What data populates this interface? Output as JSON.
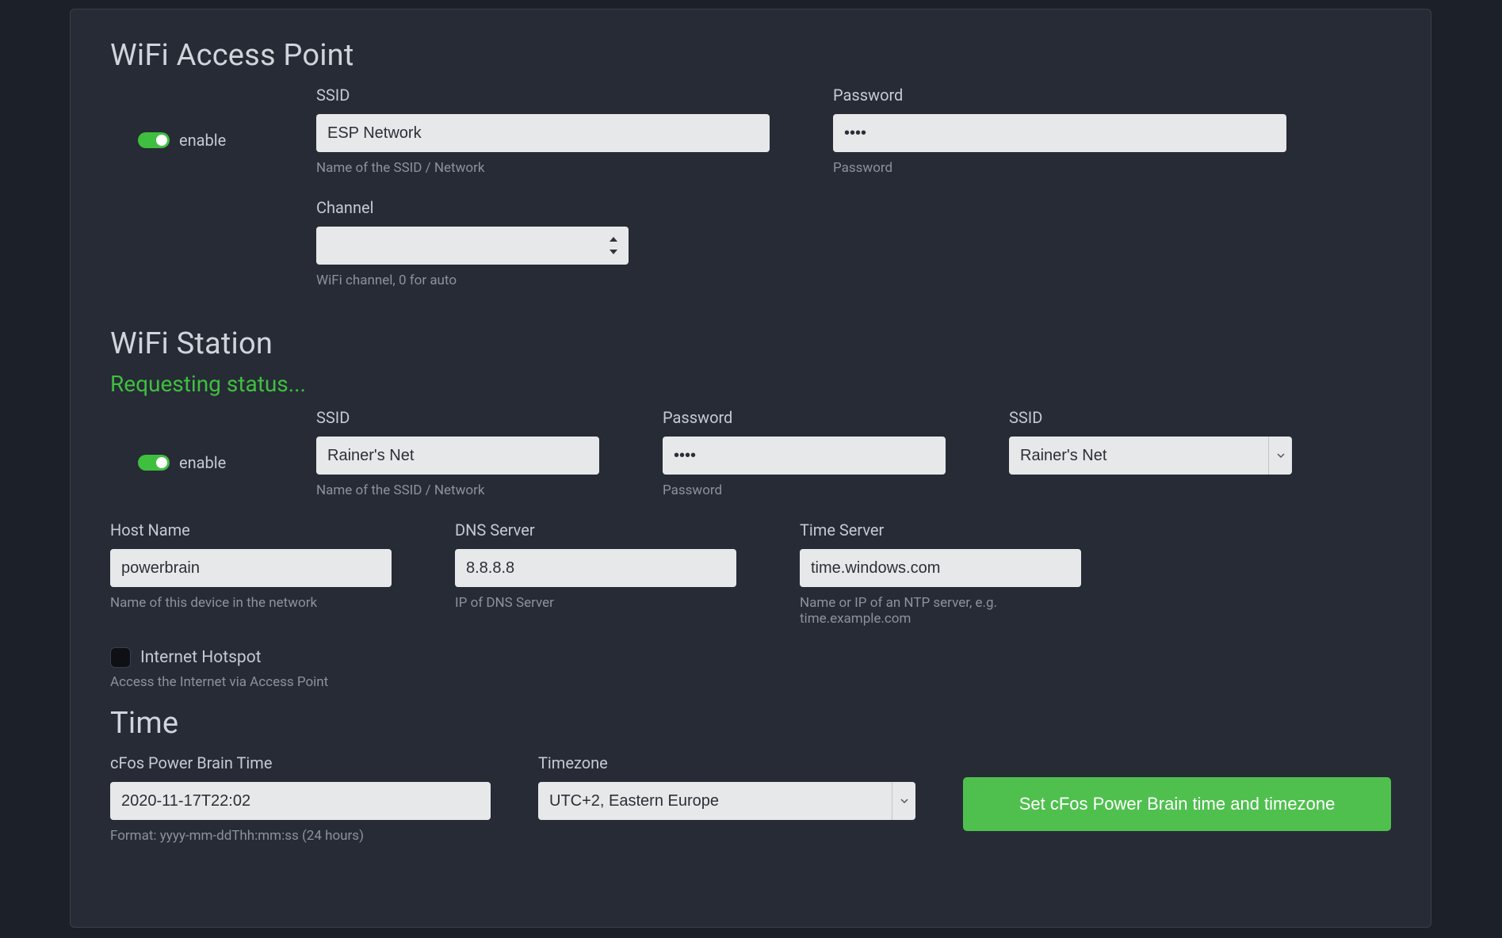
{
  "ap": {
    "title": "WiFi Access Point",
    "enable_label": "enable",
    "ssid_label": "SSID",
    "ssid_value": "ESP Network",
    "ssid_help": "Name of the SSID / Network",
    "password_label": "Password",
    "password_value": "••••",
    "password_help": "Password",
    "channel_label": "Channel",
    "channel_value": "",
    "channel_help": "WiFi channel, 0 for auto"
  },
  "station": {
    "title": "WiFi Station",
    "status": "Requesting status...",
    "enable_label": "enable",
    "ssid_label": "SSID",
    "ssid_value": "Rainer's Net",
    "ssid_help": "Name of the SSID / Network",
    "password_label": "Password",
    "password_value": "••••",
    "password_help": "Password",
    "ssid_select_label": "SSID",
    "ssid_select_value": "Rainer's Net",
    "host_label": "Host Name",
    "host_value": "powerbrain",
    "host_help": "Name of this device in the network",
    "dns_label": "DNS Server",
    "dns_value": "8.8.8.8",
    "dns_help": "IP of DNS Server",
    "timeserver_label": "Time Server",
    "timeserver_value": "time.windows.com",
    "timeserver_help": "Name or IP of an NTP server, e.g. time.example.com",
    "hotspot_label": "Internet Hotspot",
    "hotspot_help": "Access the Internet via Access Point"
  },
  "time": {
    "title": "Time",
    "clock_label": "cFos Power Brain Time",
    "clock_value": "2020-11-17T22:02",
    "clock_help": "Format: yyyy-mm-ddThh:mm:ss (24 hours)",
    "tz_label": "Timezone",
    "tz_value": "UTC+2, Eastern Europe",
    "button_label": "Set cFos Power Brain time and timezone"
  }
}
